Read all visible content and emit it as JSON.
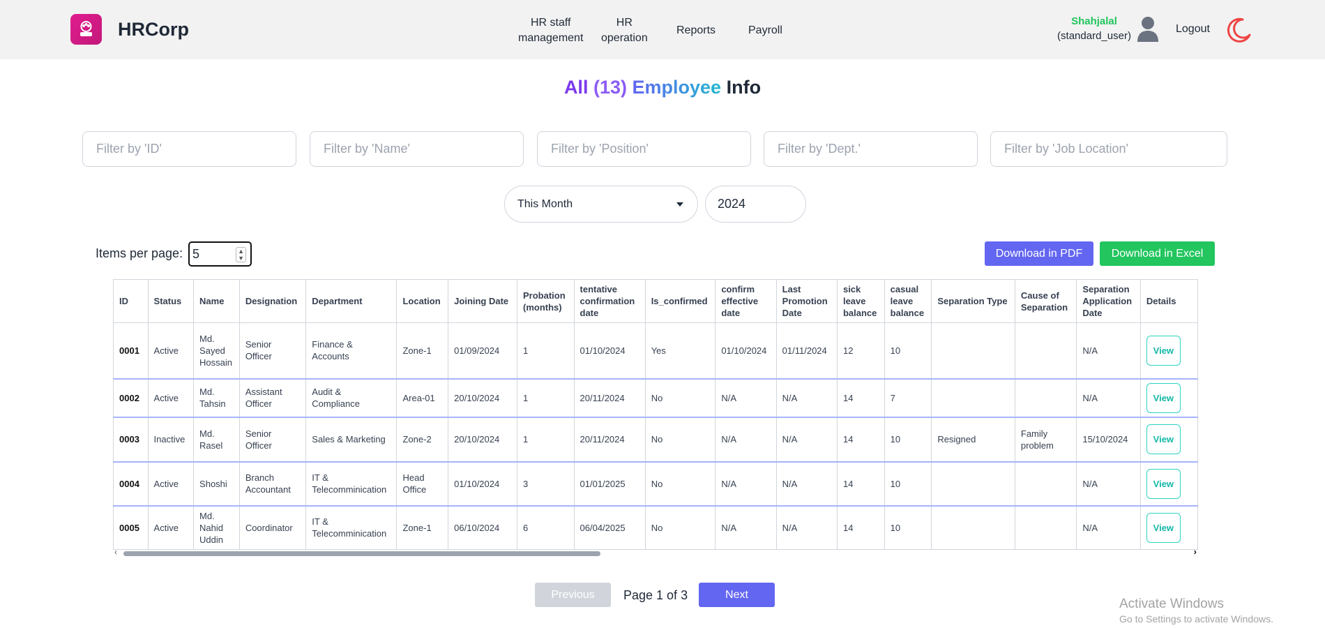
{
  "header": {
    "brand": "HRCorp",
    "nav": [
      {
        "line1": "HR staff",
        "line2": "management"
      },
      {
        "line1": "HR",
        "line2": "operation"
      },
      {
        "label": "Reports"
      },
      {
        "label": "Payroll"
      }
    ],
    "user_name": "Shahjalal",
    "user_role": "(standard_user)",
    "logout_label": "Logout"
  },
  "title": {
    "all": "All",
    "count": "(13)",
    "employee": "Employee",
    "info": "Info"
  },
  "filters": {
    "id_placeholder": "Filter by 'ID'",
    "name_placeholder": "Filter by 'Name'",
    "position_placeholder": "Filter by 'Position'",
    "dept_placeholder": "Filter by 'Dept.'",
    "location_placeholder": "Filter by 'Job Location'",
    "period_selected": "This Month",
    "year_value": "2024"
  },
  "items_per_page": {
    "label": "Items per page:",
    "value": "5"
  },
  "actions": {
    "pdf_label": "Download in PDF",
    "excel_label": "Download in Excel"
  },
  "table": {
    "columns": [
      "ID",
      "Status",
      "Name",
      "Designation",
      "Department",
      "Location",
      "Joining Date",
      "Probation (months)",
      "tentative confirmation date",
      "Is_confirmed",
      "confirm effective date",
      "Last Promotion Date",
      "sick leave balance",
      "casual leave balance",
      "Separation Type",
      "Cause of Separation",
      "Separation Application Date",
      "Details"
    ],
    "rows": [
      {
        "id": "0001",
        "status": "Active",
        "name": "Md. Sayed Hossain",
        "designation": "Senior Officer",
        "department": "Finance & Accounts",
        "location": "Zone-1",
        "joining": "01/09/2024",
        "probation": "1",
        "tentative": "01/10/2024",
        "confirmed": "Yes",
        "effective": "01/10/2024",
        "promotion": "01/11/2024",
        "sick": "12",
        "casual": "10",
        "sep_type": "",
        "sep_cause": "",
        "sep_date": "N/A",
        "details": "View"
      },
      {
        "id": "0002",
        "status": "Active",
        "name": "Md. Tahsin",
        "designation": "Assistant Officer",
        "department": "Audit & Compliance",
        "location": "Area-01",
        "joining": "20/10/2024",
        "probation": "1",
        "tentative": "20/11/2024",
        "confirmed": "No",
        "effective": "N/A",
        "promotion": "N/A",
        "sick": "14",
        "casual": "7",
        "sep_type": "",
        "sep_cause": "",
        "sep_date": "N/A",
        "details": "View"
      },
      {
        "id": "0003",
        "status": "Inactive",
        "name": "Md. Rasel",
        "designation": "Senior Officer",
        "department": "Sales & Marketing",
        "location": "Zone-2",
        "joining": "20/10/2024",
        "probation": "1",
        "tentative": "20/11/2024",
        "confirmed": "No",
        "effective": "N/A",
        "promotion": "N/A",
        "sick": "14",
        "casual": "10",
        "sep_type": "Resigned",
        "sep_cause": "Family problem",
        "sep_date": "15/10/2024",
        "details": "View"
      },
      {
        "id": "0004",
        "status": "Active",
        "name": "Shoshi",
        "designation": "Branch Accountant",
        "department": "IT & Telecomminication",
        "location": "Head Office",
        "joining": "01/10/2024",
        "probation": "3",
        "tentative": "01/01/2025",
        "confirmed": "No",
        "effective": "N/A",
        "promotion": "N/A",
        "sick": "14",
        "casual": "10",
        "sep_type": "",
        "sep_cause": "",
        "sep_date": "N/A",
        "details": "View"
      },
      {
        "id": "0005",
        "status": "Active",
        "name": "Md. Nahid Uddin",
        "designation": "Coordinator",
        "department": "IT & Telecomminication",
        "location": "Zone-1",
        "joining": "06/10/2024",
        "probation": "6",
        "tentative": "06/04/2025",
        "confirmed": "No",
        "effective": "N/A",
        "promotion": "N/A",
        "sick": "14",
        "casual": "10",
        "sep_type": "",
        "sep_cause": "",
        "sep_date": "N/A",
        "details": "View"
      }
    ]
  },
  "pagination": {
    "prev_label": "Previous",
    "page_info": "Page 1 of 3",
    "next_label": "Next"
  },
  "watermark": {
    "line1": "Activate Windows",
    "line2": "Go to Settings to activate Windows."
  },
  "colors": {
    "accent": "#6366f1",
    "success": "#22c55e",
    "brand": "#e11d8f",
    "moon": "#ef4444"
  }
}
